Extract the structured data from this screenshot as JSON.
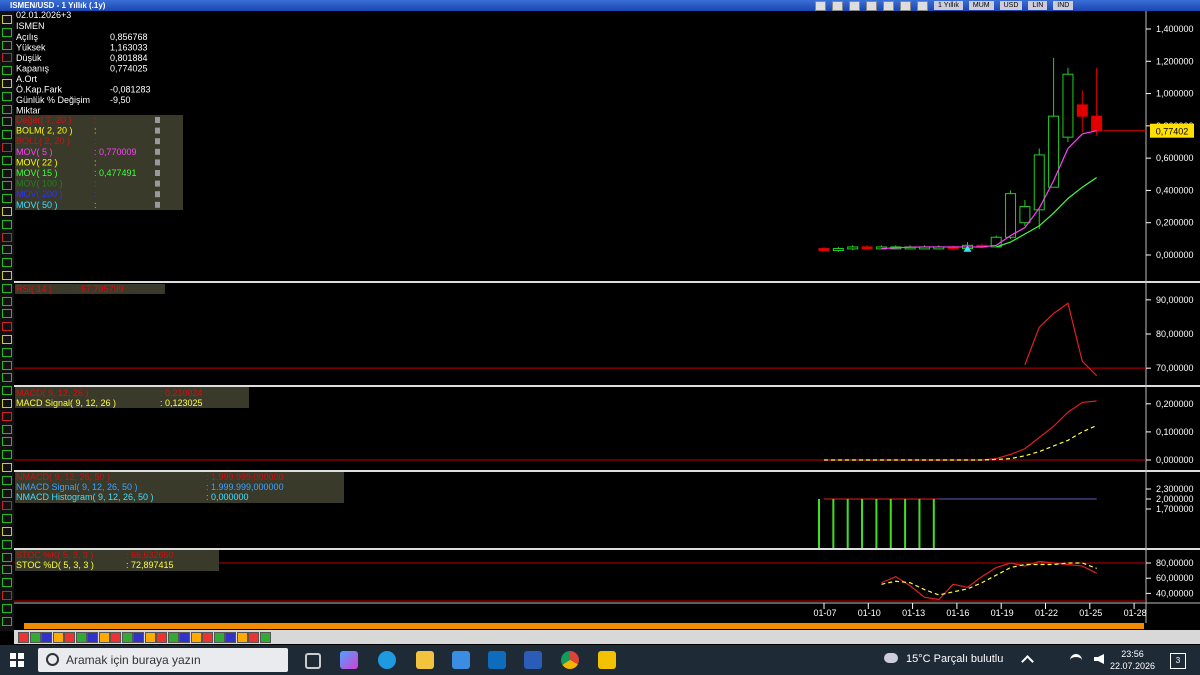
{
  "window": {
    "title": "ISMEN/USD - 1 Yıllık (.1y)"
  },
  "toolbar": {
    "period": "1 Yıllık",
    "bar_type": "MUM",
    "currency": "USD",
    "scale": "LIN",
    "mode": "IND"
  },
  "info": {
    "date": "02.01.2026+3",
    "symbol": "ISMEN",
    "rows": [
      {
        "label": "Açılış",
        "value": "0,856768"
      },
      {
        "label": "Yüksek",
        "value": "1,163033"
      },
      {
        "label": "Düşük",
        "value": "0,801884"
      },
      {
        "label": "Kapanış",
        "value": "0,774025"
      },
      {
        "label": "A.Ort",
        "value": ""
      },
      {
        "label": "Ö.Kap.Fark",
        "value": "-0,081283"
      },
      {
        "label": "Günlük % Değişim",
        "value": "-9,50"
      },
      {
        "label": "Miktar",
        "value": ""
      }
    ]
  },
  "indicators": [
    {
      "label": "Değer( 7, 20 )",
      "value": "",
      "color": "#d01010"
    },
    {
      "label": "BOLM( 2, 20 )",
      "value": "",
      "color": "#ffff00"
    },
    {
      "label": "BOLL( 2, 20 )",
      "value": "",
      "color": "#d01010"
    },
    {
      "label": "MOV( 5 )",
      "value": "0,770009",
      "color": "#ff40ff"
    },
    {
      "label": "MOV( 22 )",
      "value": "",
      "color": "#ffff00"
    },
    {
      "label": "MOV( 15 )",
      "value": "0,477491",
      "color": "#40ff40"
    },
    {
      "label": "MOV( 100 )",
      "value": "",
      "color": "#208020"
    },
    {
      "label": "MOV( 200 )",
      "value": "",
      "color": "#3030ff"
    },
    {
      "label": "MOV( 50 )",
      "value": "",
      "color": "#40e0ff"
    }
  ],
  "price_axis": {
    "ticks": [
      "1,400000",
      "1,200000",
      "1,000000",
      "0,800000",
      "0,600000",
      "0,400000",
      "0,200000",
      "0,000000"
    ],
    "last": "0,77402"
  },
  "rsi": {
    "label": "RSI( 14 )",
    "value": "67,795799",
    "ticks": [
      "90,00000",
      "80,00000",
      "70,00000"
    ]
  },
  "macd": {
    "label": "MACD( 9, 12, 26 )",
    "value": "0,210024",
    "signal_label": "MACD Signal( 9, 12, 26 )",
    "signal_value": "0,123025",
    "ticks": [
      "0,200000",
      "0,100000",
      "0,000000"
    ]
  },
  "nmacd": {
    "label": "NMACD( 9, 12, 26, 50 )",
    "value": "1.999.999,000000",
    "signal_label": "NMACD Signal( 9, 12, 26, 50 )",
    "signal_value": "1.999.999,000000",
    "hist_label": "NMACD Histogram( 9, 12, 26, 50 )",
    "hist_value": "0,000000",
    "ticks": [
      "2,300000",
      "2,000000",
      "1,700000"
    ]
  },
  "stoc": {
    "k_label": "STOC %K( 5, 3, 3 )",
    "k_value": "66,632660",
    "d_label": "STOC %D( 5, 3, 3 )",
    "d_value": "72,897415",
    "ticks": [
      "80,00000",
      "60,00000",
      "40,00000"
    ]
  },
  "x_axis": {
    "ticks": [
      "01-07",
      "01-10",
      "01-13",
      "01-16",
      "01-19",
      "01-22",
      "01-25",
      "01-28"
    ]
  },
  "taskbar": {
    "search_placeholder": "Aramak için buraya yazın",
    "weather": "15°C  Parçalı bulutlu",
    "time": "23:56",
    "date": "22.07.2026",
    "notifications": "3"
  },
  "chart_data": {
    "type": "candlestick",
    "categories": [
      "01-07",
      "01-08",
      "01-09",
      "01-10",
      "01-11",
      "01-12",
      "01-13",
      "01-14",
      "01-15",
      "01-16",
      "01-17",
      "01-18",
      "01-19",
      "01-20",
      "01-21",
      "01-22",
      "01-23",
      "01-24",
      "01-25",
      "01-26"
    ],
    "open": [
      0.04,
      0.03,
      0.04,
      0.05,
      0.04,
      0.05,
      0.05,
      0.05,
      0.05,
      0.05,
      0.04,
      0.06,
      0.05,
      0.11,
      0.2,
      0.28,
      0.42,
      0.73,
      0.93,
      0.86
    ],
    "close": [
      0.03,
      0.04,
      0.05,
      0.04,
      0.05,
      0.05,
      0.05,
      0.05,
      0.05,
      0.04,
      0.06,
      0.05,
      0.11,
      0.38,
      0.3,
      0.62,
      0.86,
      1.12,
      0.86,
      0.77
    ],
    "high": [
      0.05,
      0.05,
      0.06,
      0.06,
      0.06,
      0.06,
      0.06,
      0.06,
      0.06,
      0.06,
      0.08,
      0.07,
      0.12,
      0.4,
      0.34,
      0.66,
      1.22,
      1.16,
      1.02,
      1.16
    ],
    "low": [
      0.02,
      0.02,
      0.03,
      0.03,
      0.04,
      0.04,
      0.04,
      0.04,
      0.04,
      0.03,
      0.03,
      0.04,
      0.05,
      0.1,
      0.18,
      0.16,
      0.42,
      0.7,
      0.76,
      0.74
    ],
    "ylim": [
      0,
      1.45
    ],
    "mov5": [
      null,
      null,
      null,
      null,
      0.04,
      0.045,
      0.048,
      0.05,
      0.05,
      0.05,
      0.05,
      0.05,
      0.06,
      0.12,
      0.17,
      0.29,
      0.46,
      0.66,
      0.75,
      0.77
    ],
    "mov15": [
      null,
      null,
      null,
      null,
      null,
      null,
      null,
      null,
      null,
      null,
      null,
      null,
      0.05,
      0.08,
      0.13,
      0.18,
      0.26,
      0.35,
      0.42,
      0.48
    ],
    "rsi": [
      null,
      null,
      null,
      null,
      null,
      null,
      null,
      null,
      null,
      null,
      null,
      null,
      null,
      null,
      71,
      82,
      86,
      89,
      72,
      67.8
    ],
    "macd": [
      0,
      0,
      0,
      0,
      0,
      0,
      0,
      0,
      0,
      0,
      0,
      0,
      0.005,
      0.02,
      0.04,
      0.08,
      0.12,
      0.17,
      0.205,
      0.21
    ],
    "macd_signal": [
      0,
      0,
      0,
      0,
      0,
      0,
      0,
      0,
      0,
      0,
      0,
      0,
      0.002,
      0.005,
      0.015,
      0.03,
      0.05,
      0.07,
      0.1,
      0.123
    ],
    "stoc_k": [
      null,
      null,
      null,
      null,
      54,
      62,
      50,
      35,
      32,
      52,
      48,
      62,
      74,
      80,
      76,
      82,
      80,
      78,
      76,
      66.6
    ],
    "stoc_d": [
      null,
      null,
      null,
      null,
      52,
      56,
      54,
      45,
      38,
      42,
      46,
      54,
      64,
      74,
      78,
      78,
      78,
      80,
      80,
      72.9
    ]
  }
}
